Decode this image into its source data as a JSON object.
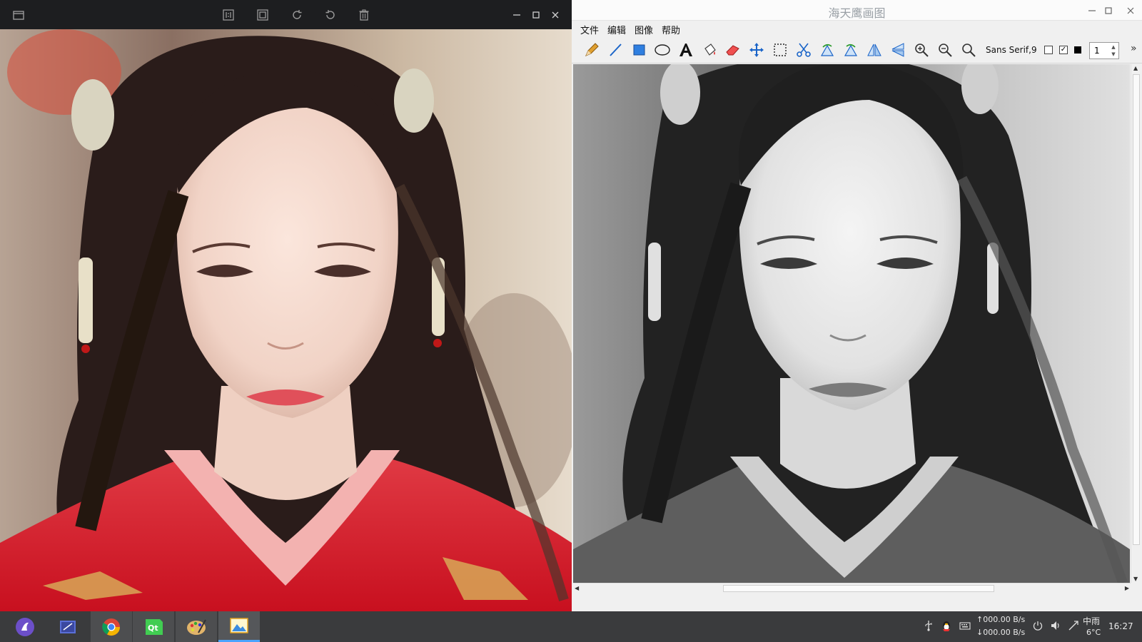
{
  "viewer": {
    "toolbar_icons": [
      "sidebar-icon",
      "original-size-icon",
      "fit-window-icon",
      "rotate-clockwise-icon",
      "rotate-counterclockwise-icon",
      "delete-icon"
    ],
    "window_controls": [
      "minimize-icon",
      "maximize-icon",
      "close-icon"
    ]
  },
  "paint": {
    "title": "海天鹰画图",
    "menu": [
      "文件",
      "编辑",
      "图像",
      "帮助"
    ],
    "tools": [
      "pencil-icon",
      "line-icon",
      "rectangle-icon",
      "ellipse-icon",
      "text-icon",
      "fill-bucket-icon",
      "eraser-icon",
      "move-icon",
      "select-rect-icon",
      "cut-icon",
      "rotate-left-icon",
      "rotate-right-icon",
      "flip-horizontal-icon",
      "flip-vertical-icon",
      "zoom-in-icon",
      "zoom-out-icon",
      "zoom-reset-icon"
    ],
    "font": "Sans Serif,9",
    "checkbox1": "",
    "checkbox2": "✓",
    "line_width": "1",
    "more": "»"
  },
  "taskbar": {
    "apps": [
      "launcher-icon",
      "editor-icon",
      "chrome-icon",
      "qt-creator-icon",
      "paint-palette-icon",
      "image-viewer-icon"
    ],
    "net_up": "↑000.00 B/s",
    "net_down": "↓000.00 B/s",
    "weather": "中雨",
    "temperature": "6°C",
    "time": "16:27"
  },
  "colors": {
    "accent": "#4aa3ff",
    "dress_red": "#d81e2e"
  }
}
